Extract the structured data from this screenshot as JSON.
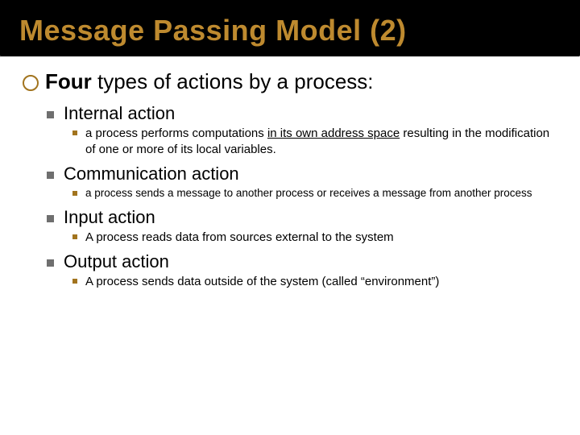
{
  "title": "Message Passing Model (2)",
  "main": {
    "bold": "Four",
    "rest": " types of actions by a process:"
  },
  "items": [
    {
      "heading": "Internal action",
      "detail_pre": "a process performs computations ",
      "detail_underline": "in its own address space",
      "detail_post": " resulting in the modification of one or more of its local variables.",
      "small": false
    },
    {
      "heading": "Communication action",
      "detail_pre": "a process sends a message to another process or receives a message from another process",
      "detail_underline": "",
      "detail_post": "",
      "small": true
    },
    {
      "heading": "Input action",
      "detail_pre": "A process reads data from sources external to the system",
      "detail_underline": "",
      "detail_post": "",
      "small": false
    },
    {
      "heading": "Output action",
      "detail_pre": "A process sends data outside of the system (called “environment”)",
      "detail_underline": "",
      "detail_post": "",
      "small": false
    }
  ]
}
